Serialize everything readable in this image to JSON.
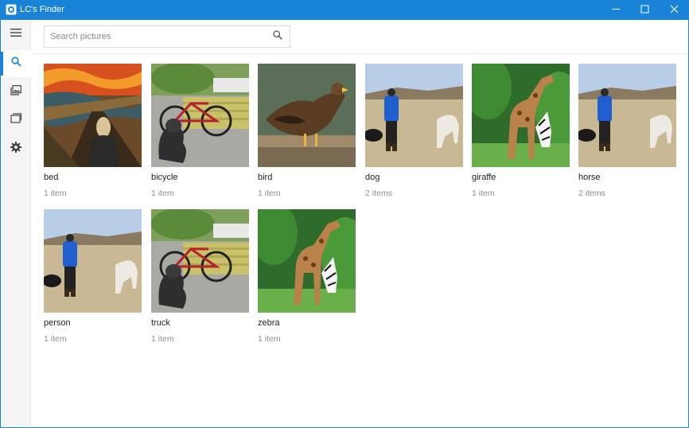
{
  "window": {
    "title": "LC's Finder",
    "accent": "#1883d7",
    "controls": {
      "minimize": "minimize-icon",
      "maximize": "maximize-icon",
      "close": "close-icon"
    }
  },
  "sidebar": {
    "items": [
      {
        "icon": "hamburger-menu-icon",
        "active": false
      },
      {
        "icon": "search-icon",
        "active": true
      },
      {
        "icon": "photo-icon",
        "active": false
      },
      {
        "icon": "folder-icon",
        "active": false
      },
      {
        "icon": "gear-icon",
        "active": false
      }
    ]
  },
  "search": {
    "placeholder": "Search pictures",
    "value": "",
    "icon": "search-icon"
  },
  "categories": [
    {
      "label": "bed",
      "count": "1 item",
      "image": "painting-the-scream"
    },
    {
      "label": "bicycle",
      "count": "1 item",
      "image": "dog-with-bicycle"
    },
    {
      "label": "bird",
      "count": "1 item",
      "image": "eagle"
    },
    {
      "label": "dog",
      "count": "2 items",
      "image": "person-dog-horse"
    },
    {
      "label": "giraffe",
      "count": "1 item",
      "image": "giraffe-zebra"
    },
    {
      "label": "horse",
      "count": "2 items",
      "image": "person-dog-horse"
    },
    {
      "label": "person",
      "count": "1 item",
      "image": "person-dog-horse"
    },
    {
      "label": "truck",
      "count": "1 item",
      "image": "dog-with-bicycle"
    },
    {
      "label": "zebra",
      "count": "1 item",
      "image": "giraffe-zebra"
    }
  ]
}
